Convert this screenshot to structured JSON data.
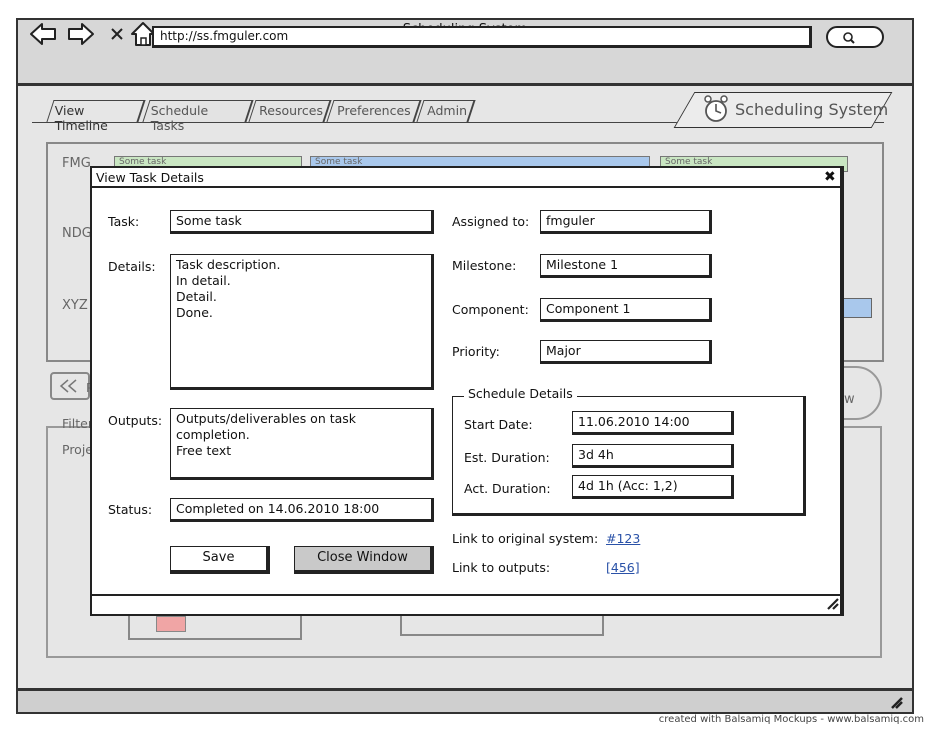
{
  "window": {
    "title": "Scheduling System",
    "url": "http://ss.fmguler.com"
  },
  "tabs": [
    {
      "label": "View Timeline",
      "active": true
    },
    {
      "label": "Schedule Tasks",
      "active": false
    },
    {
      "label": "Resources",
      "active": false
    },
    {
      "label": "Preferences",
      "active": false
    },
    {
      "label": "Admin",
      "active": false
    }
  ],
  "logo": {
    "text": "Scheduling System",
    "icon": "alarm-clock-icon"
  },
  "background": {
    "rows": [
      "FMG",
      "NDG",
      "XYZ"
    ],
    "task_bars": [
      "Some task",
      "Some task",
      "Some task"
    ],
    "bar_colors": {
      "green": "#c9e6c2",
      "blue": "#a9c8ec"
    },
    "filter_label": "Filter",
    "project_label": "Proje",
    "view_button": "ew",
    "rewind_letter": "P"
  },
  "modal": {
    "title": "View Task Details",
    "task": {
      "label": "Task:",
      "value": "Some task"
    },
    "details": {
      "label": "Details:",
      "value": "Task description.\nIn detail.\nDetail.\nDone."
    },
    "outputs": {
      "label": "Outputs:",
      "value": "Outputs/deliverables on task completion.\nFree text"
    },
    "status": {
      "label": "Status:",
      "value": "Completed on 14.06.2010   18:00"
    },
    "save_label": "Save",
    "close_label": "Close Window",
    "assigned": {
      "label": "Assigned to:",
      "value": "fmguler"
    },
    "milestone": {
      "label": "Milestone:",
      "value": "Milestone 1"
    },
    "component": {
      "label": "Component:",
      "value": "Component 1"
    },
    "priority": {
      "label": "Priority:",
      "value": "Major"
    },
    "schedule": {
      "legend": "Schedule Details",
      "start": {
        "label": "Start Date:",
        "value": "11.06.2010  14:00"
      },
      "est": {
        "label": "Est. Duration:",
        "value": "3d 4h"
      },
      "act": {
        "label": "Act. Duration:",
        "value": "4d 1h (Acc: 1,2)"
      }
    },
    "link_original": {
      "label": "Link to original system:",
      "value": "#123"
    },
    "link_outputs": {
      "label": "Link to outputs:",
      "value": "[456]"
    }
  },
  "credit": "created with Balsamiq Mockups - www.balsamiq.com"
}
